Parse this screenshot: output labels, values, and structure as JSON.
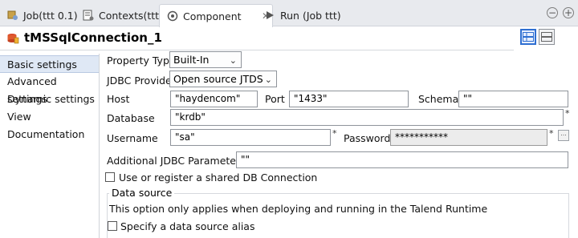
{
  "tabs": [
    {
      "label": "Job(ttt 0.1)",
      "icon": "job-icon"
    },
    {
      "label": "Contexts(ttt)",
      "icon": "contexts-icon"
    },
    {
      "label": "Component",
      "icon": "component-icon"
    },
    {
      "label": "Run (Job ttt)",
      "icon": "run-icon"
    }
  ],
  "tab_close": "✕",
  "window_controls": {
    "minimize": "−",
    "maximize": "+"
  },
  "component": {
    "title": "tMSSqlConnection_1"
  },
  "nav": {
    "items": [
      {
        "label": "Basic settings",
        "selected": true
      },
      {
        "label": "Advanced settings"
      },
      {
        "label": "Dynamic settings"
      },
      {
        "label": "View"
      },
      {
        "label": "Documentation"
      }
    ]
  },
  "form": {
    "property_type": {
      "label": "Property Type",
      "value": "Built-In"
    },
    "jdbc_provider": {
      "label": "JDBC Provider",
      "value": "Open source JTDS"
    },
    "host": {
      "label": "Host",
      "value": "\"haydencom\""
    },
    "port": {
      "label": "Port",
      "value": "\"1433\""
    },
    "schema": {
      "label": "Schema",
      "value": "\"\""
    },
    "database": {
      "label": "Database",
      "value": "\"krdb\""
    },
    "username": {
      "label": "Username",
      "value": "\"sa\""
    },
    "password": {
      "label": "Password",
      "value": "***********"
    },
    "additional_params": {
      "label": "Additional JDBC Parameters",
      "value": "\"\""
    },
    "shared_connection": {
      "label": "Use or register a shared DB Connection",
      "checked": false
    },
    "data_source": {
      "group_title": "Data source",
      "note": "This option only applies when deploying and running in the Talend Runtime",
      "alias_checkbox": {
        "label": "Specify a data source alias",
        "checked": false
      }
    },
    "required_mark": "*",
    "dots_label": "..."
  },
  "colors": {
    "tab_bar": "#e8eaee",
    "selected_nav": "#dfe8f5",
    "accent": "#2f6fd1"
  }
}
